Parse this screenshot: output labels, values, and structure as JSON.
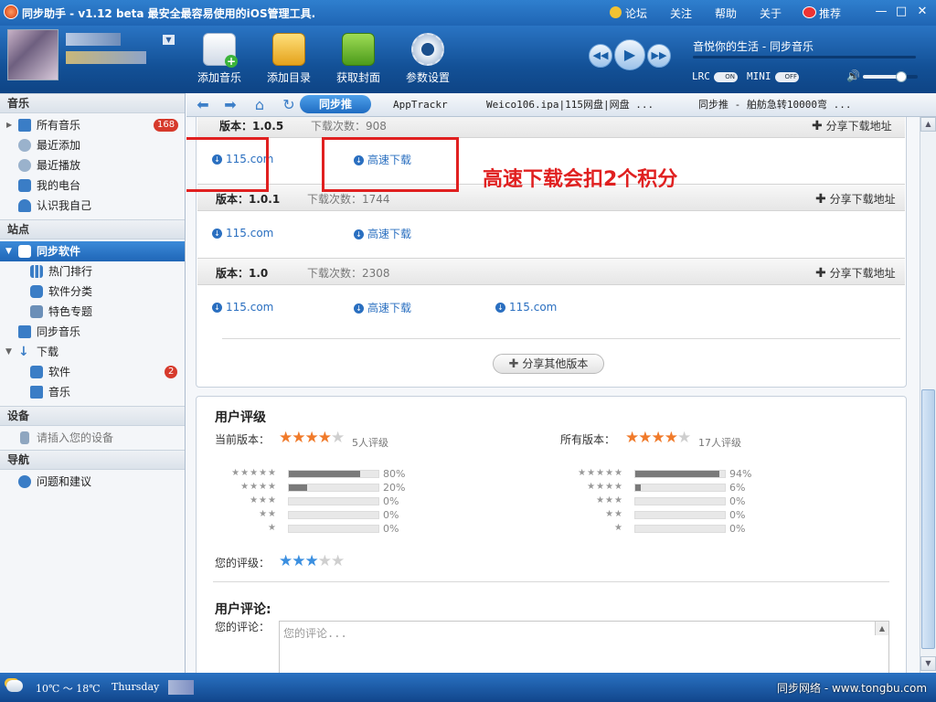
{
  "app": {
    "title": "同步助手 - v1.12 beta  最安全最容易使用的iOS管理工具.",
    "top_links": [
      "论坛",
      "关注",
      "帮助",
      "关于",
      "推荐"
    ]
  },
  "toolbar": {
    "items": [
      "添加音乐",
      "添加目录",
      "获取封面",
      "参数设置"
    ]
  },
  "player": {
    "now_playing": "音悦你的生活 - 同步音乐",
    "lrc_label": "LRC",
    "lrc_state": "ON",
    "mini_label": "MINI",
    "mini_state": "OFF",
    "volume": 0.7
  },
  "nav": {
    "active_tab": "同步推",
    "tabs": [
      "AppTrackr",
      "Weico106.ipa|115网盘|网盘  ...",
      "同步推 - 舶舫急转10000弯  ..."
    ]
  },
  "sidebar": {
    "sections": [
      "音乐",
      "站点",
      "设备",
      "导航"
    ],
    "music": [
      {
        "label": "所有音乐",
        "badge": "168"
      },
      {
        "label": "最近添加"
      },
      {
        "label": "最近播放"
      },
      {
        "label": "我的电台"
      },
      {
        "label": "认识我自己"
      }
    ],
    "sites": [
      {
        "label": "同步软件"
      },
      {
        "label": "热门排行"
      },
      {
        "label": "软件分类"
      },
      {
        "label": "特色专题"
      },
      {
        "label": "同步音乐"
      },
      {
        "label": "下载"
      },
      {
        "label": "软件",
        "badge": "2"
      },
      {
        "label": "音乐"
      }
    ],
    "device": "请插入您的设备",
    "nav_item": "问题和建议"
  },
  "versions": [
    {
      "label": "版本：1.0.5",
      "count": "下载次数：908",
      "share": "分享下载地址",
      "links": [
        "115.com",
        "高速下载"
      ]
    },
    {
      "label": "版本：1.0.1",
      "count": "下载次数：1744",
      "share": "分享下载地址",
      "links": [
        "115.com",
        "高速下载"
      ]
    },
    {
      "label": "版本：1.0",
      "count": "下载次数：2308",
      "share": "分享下载地址",
      "links": [
        "115.com",
        "高速下载",
        "115.com"
      ]
    }
  ],
  "annotation": "高速下载会扣2个积分",
  "share_other": "分享其他版本",
  "rating": {
    "title": "用户评级",
    "current_label": "当前版本：",
    "current_stars": 4,
    "current_count": "5人评级",
    "all_label": "所有版本：",
    "all_stars": 4,
    "all_count": "17人评级",
    "current_dist": [
      {
        "stars": 5,
        "percent": "80%",
        "value": 0.8
      },
      {
        "stars": 4,
        "percent": "20%",
        "value": 0.2
      },
      {
        "stars": 3,
        "percent": "0%",
        "value": 0
      },
      {
        "stars": 2,
        "percent": "0%",
        "value": 0
      },
      {
        "stars": 1,
        "percent": "0%",
        "value": 0
      }
    ],
    "all_dist": [
      {
        "stars": 5,
        "percent": "94%",
        "value": 0.94
      },
      {
        "stars": 4,
        "percent": "6%",
        "value": 0.06
      },
      {
        "stars": 3,
        "percent": "0%",
        "value": 0
      },
      {
        "stars": 2,
        "percent": "0%",
        "value": 0
      },
      {
        "stars": 1,
        "percent": "0%",
        "value": 0
      }
    ],
    "your_label": "您的评级：",
    "your_stars": 3
  },
  "comments": {
    "title": "用户评论:",
    "label": "您的评论：",
    "placeholder": "您的评论..."
  },
  "status": {
    "weather": "10℃ ～ 18℃",
    "day": "Thursday",
    "watermark": "同步网络 - www.tongbu.com"
  }
}
